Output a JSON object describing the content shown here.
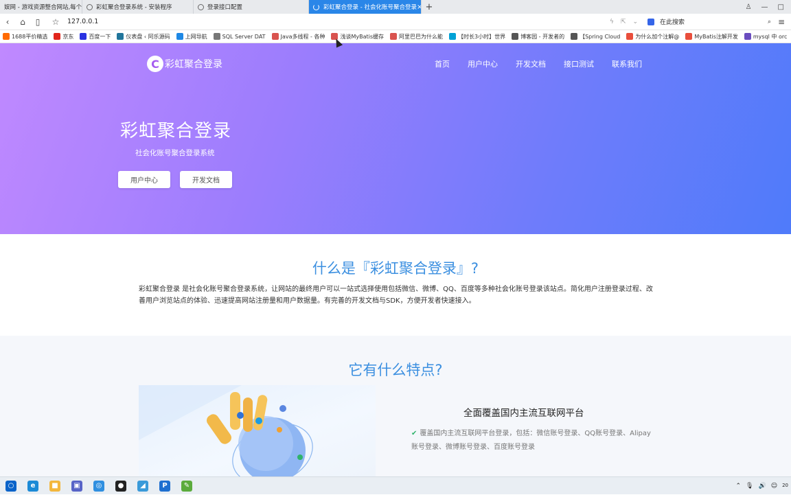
{
  "browser": {
    "tabs": [
      {
        "title": "娱网 - 游戏资源整合网站,每个",
        "active": false
      },
      {
        "title": "彩虹聚合登录系统 - 安装程序",
        "active": false
      },
      {
        "title": "登录接口配置",
        "active": false
      },
      {
        "title": "彩虹聚合登录 - 社会化账号聚合登录",
        "active": true
      }
    ],
    "new_tab": "+",
    "url": "127.0.0.1",
    "search_placeholder": "在此搜索",
    "bookmarks": [
      {
        "label": "1688平价精选",
        "color": "#ff6a00"
      },
      {
        "label": "京东",
        "color": "#e1251b"
      },
      {
        "label": "百度一下",
        "color": "#2932e1"
      },
      {
        "label": "仪表盘 ‹ 阿乐源码",
        "color": "#21759b"
      },
      {
        "label": "上网导航",
        "color": "#1e88e5"
      },
      {
        "label": "SQL Server DAT",
        "color": "#777777"
      },
      {
        "label": "Java多线程 - 各种",
        "color": "#d9534f"
      },
      {
        "label": "浅谈MyBatis缓存",
        "color": "#d9534f"
      },
      {
        "label": "阿里巴巴为什么能",
        "color": "#d9534f"
      },
      {
        "label": "【时长3小时】世界",
        "color": "#00a1d6"
      },
      {
        "label": "博客园 - 开发者的",
        "color": "#555555"
      },
      {
        "label": "【Spring Cloud",
        "color": "#555555"
      },
      {
        "label": "为什么加个注解@",
        "color": "#e94e3c"
      },
      {
        "label": "MyBatis注解开发",
        "color": "#e94e3c"
      },
      {
        "label": "mysql 中 orc",
        "color": "#6a4dbf"
      }
    ]
  },
  "site": {
    "logo_text": "彩虹聚合登录",
    "logo_letter": "C",
    "nav": [
      "首页",
      "用户中心",
      "开发文档",
      "接口测试",
      "联系我们"
    ],
    "hero_title": "彩虹聚合登录",
    "hero_subtitle": "社会化账号聚合登录系统",
    "hero_buttons": [
      "用户中心",
      "开发文档"
    ],
    "about_title": "什么是『彩虹聚合登录』?",
    "about_text": "彩虹聚合登录 是社会化账号聚合登录系统，让网站的最终用户可以一站式选择使用包括微信、微博、QQ、百度等多种社会化账号登录该站点。简化用户注册登录过程、改善用户浏览站点的体验、迅速提高网站注册量和用户数据量。有完善的开发文档与SDK，方便开发者快速接入。",
    "features_title": "它有什么特点?",
    "feature_title": "全面覆盖国内主流互联网平台",
    "feature_desc": "覆盖国内主流互联网平台登录，包括：微信账号登录、QQ账号登录、Alipay账号登录、微博账号登录、百度账号登录"
  },
  "taskbar": {
    "apps": [
      {
        "name": "search-icon",
        "color": "#0a63c9",
        "glyph": "○"
      },
      {
        "name": "edge-icon",
        "color": "#1b8ad6",
        "glyph": "e"
      },
      {
        "name": "folder-icon",
        "color": "#f3b73d",
        "glyph": "■"
      },
      {
        "name": "app-icon",
        "color": "#5763c7",
        "glyph": "▣"
      },
      {
        "name": "browser-icon",
        "color": "#2f8fe0",
        "glyph": "◎"
      },
      {
        "name": "record-icon",
        "color": "#222222",
        "glyph": "●"
      },
      {
        "name": "tool-icon",
        "color": "#3a9ad9",
        "glyph": "◢"
      },
      {
        "name": "p-app-icon",
        "color": "#1e6fd0",
        "glyph": "P"
      },
      {
        "name": "editor-icon",
        "color": "#5bab3c",
        "glyph": "✎"
      }
    ],
    "clock_top": "",
    "clock_bottom": "20"
  }
}
